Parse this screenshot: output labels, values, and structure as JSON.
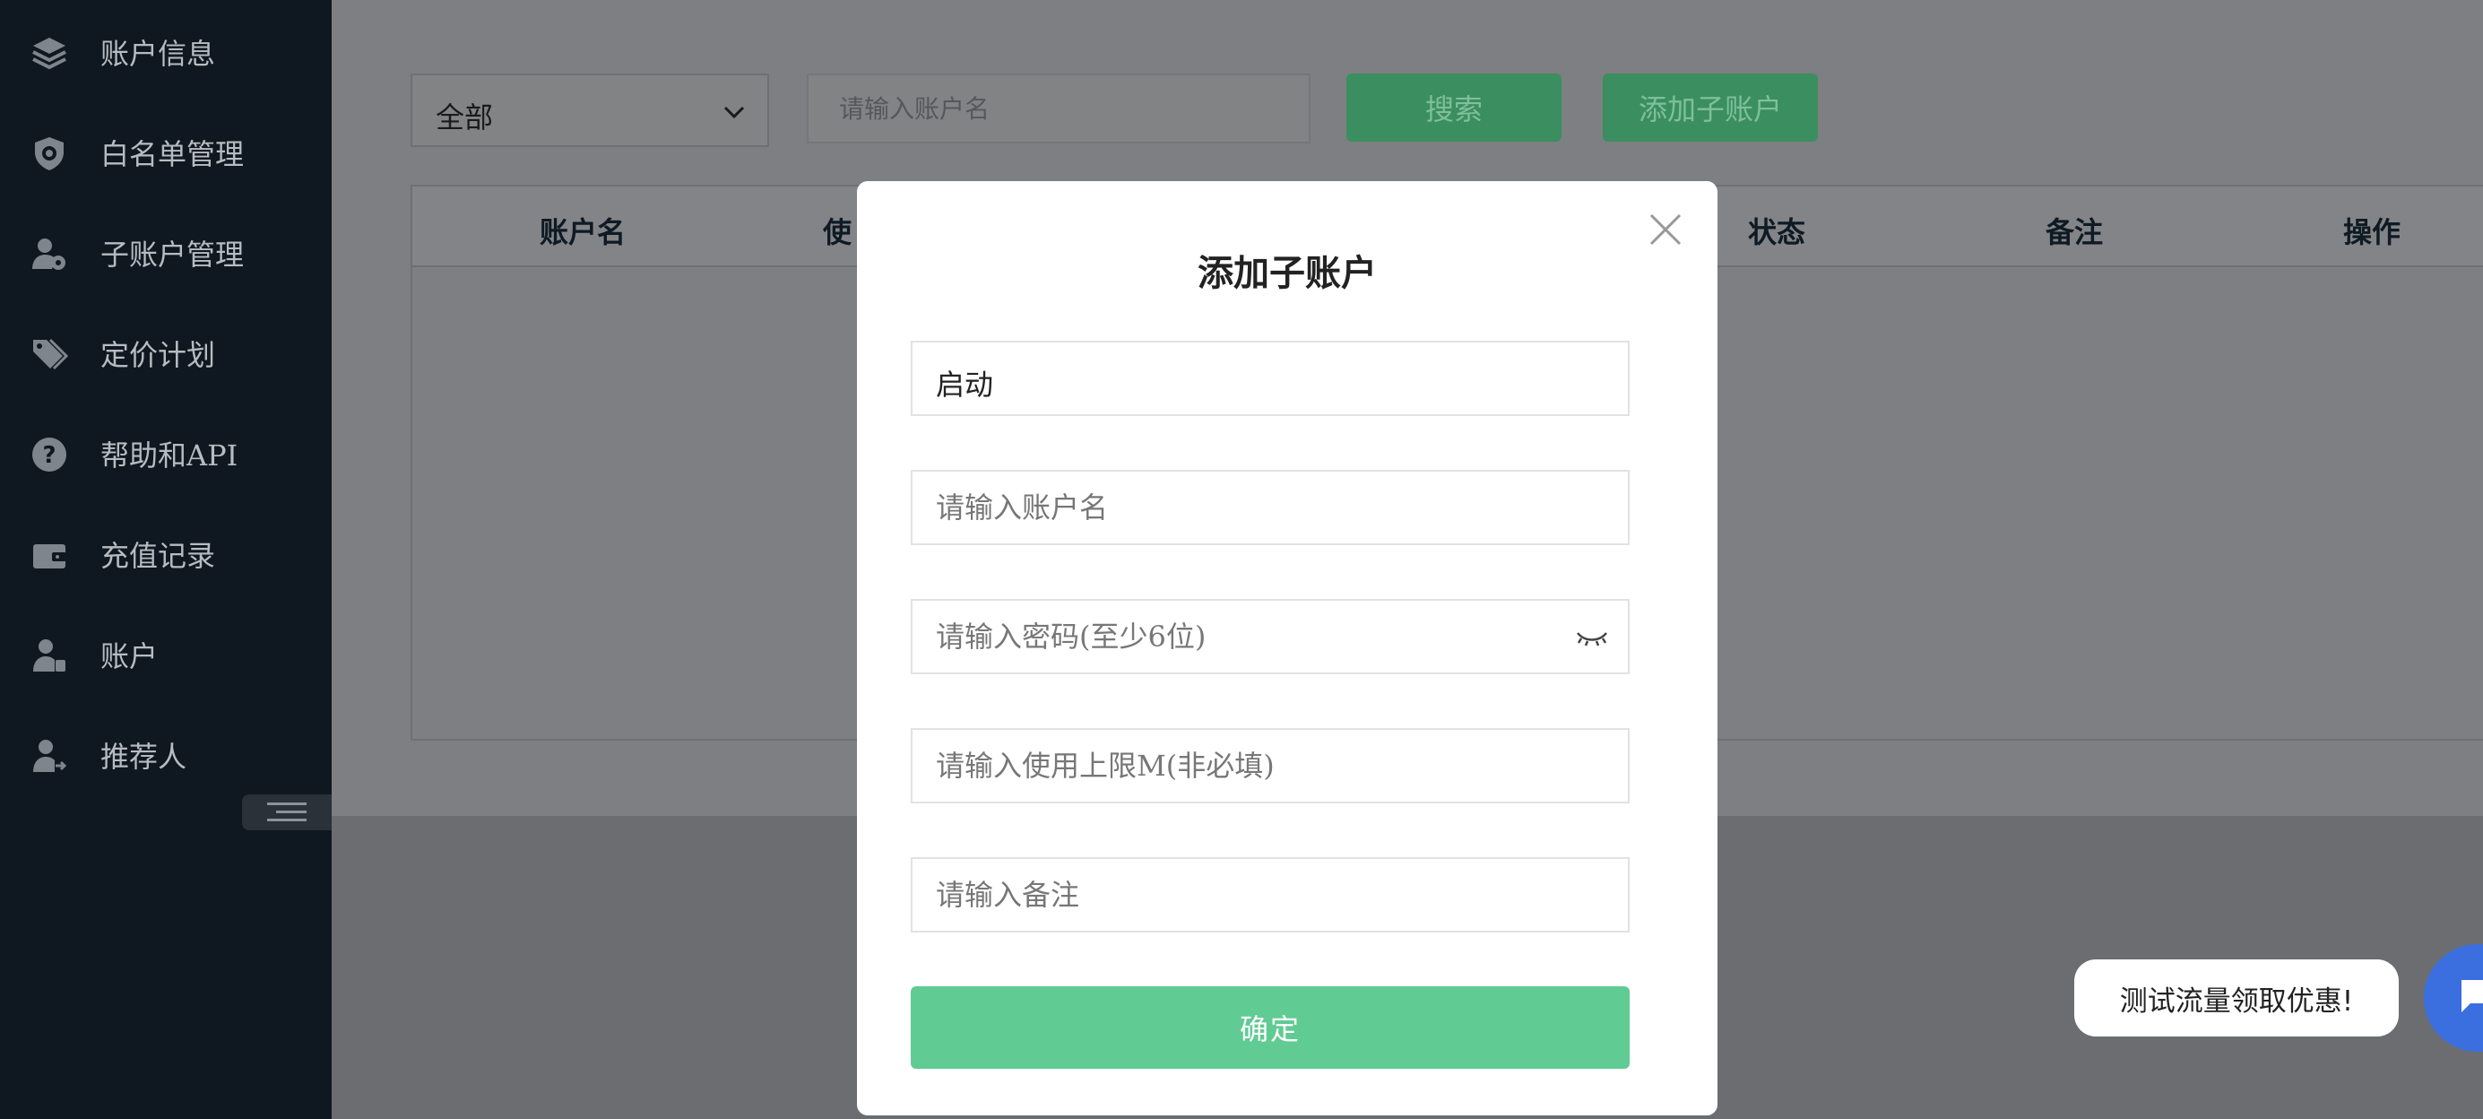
{
  "sidebar": {
    "items": [
      {
        "label": "账户信息",
        "icon": "layers-icon"
      },
      {
        "label": "白名单管理",
        "icon": "shield-icon"
      },
      {
        "label": "子账户管理",
        "icon": "user-gear-icon"
      },
      {
        "label": "定价计划",
        "icon": "tags-icon"
      },
      {
        "label": "帮助和API",
        "icon": "question-circle-icon"
      },
      {
        "label": "充值记录",
        "icon": "wallet-icon"
      },
      {
        "label": "账户",
        "icon": "user-badge-icon"
      },
      {
        "label": "推荐人",
        "icon": "user-share-icon"
      }
    ]
  },
  "filters": {
    "status_select": "全部",
    "search_placeholder": "请输入账户名",
    "search_button": "搜索",
    "add_button": "添加子账户"
  },
  "table": {
    "columns": [
      "账户名",
      "使",
      "状态",
      "备注",
      "操作"
    ]
  },
  "modal": {
    "title": "添加子账户",
    "status_value": "启动",
    "username_placeholder": "请输入账户名",
    "password_placeholder": "请输入密码(至少6位)",
    "limit_placeholder": "请输入使用上限M(非必填)",
    "note_placeholder": "请输入备注",
    "confirm_button": "确定"
  },
  "chat": {
    "bubble_text": "测试流量领取优惠!"
  },
  "colors": {
    "sidebar_bg": "#0f1820",
    "accent_green": "#60cb93",
    "overlay": "#7b7d80",
    "chat_blue": "#3b6fe0"
  }
}
